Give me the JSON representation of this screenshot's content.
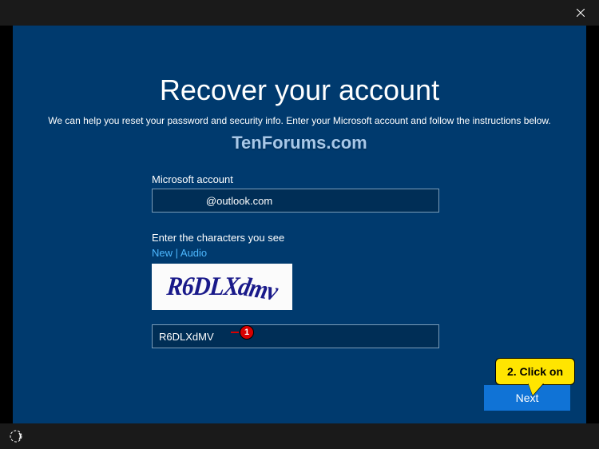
{
  "title": "Recover your account",
  "subtitle": "We can help you reset your password and security info. Enter your Microsoft account and follow the instructions below.",
  "watermark": "TenForums.com",
  "form": {
    "account_label": "Microsoft account",
    "account_value": "        @outlook.com",
    "captcha_label": "Enter the characters you see",
    "new_link": "New",
    "audio_link": "Audio",
    "link_separator": " | ",
    "captcha_image_text": "R6DLXdMV",
    "captcha_input_value": "R6DLXdMV"
  },
  "buttons": {
    "next": "Next"
  },
  "callouts": {
    "marker1": "1",
    "balloon2": "2. Click on"
  }
}
